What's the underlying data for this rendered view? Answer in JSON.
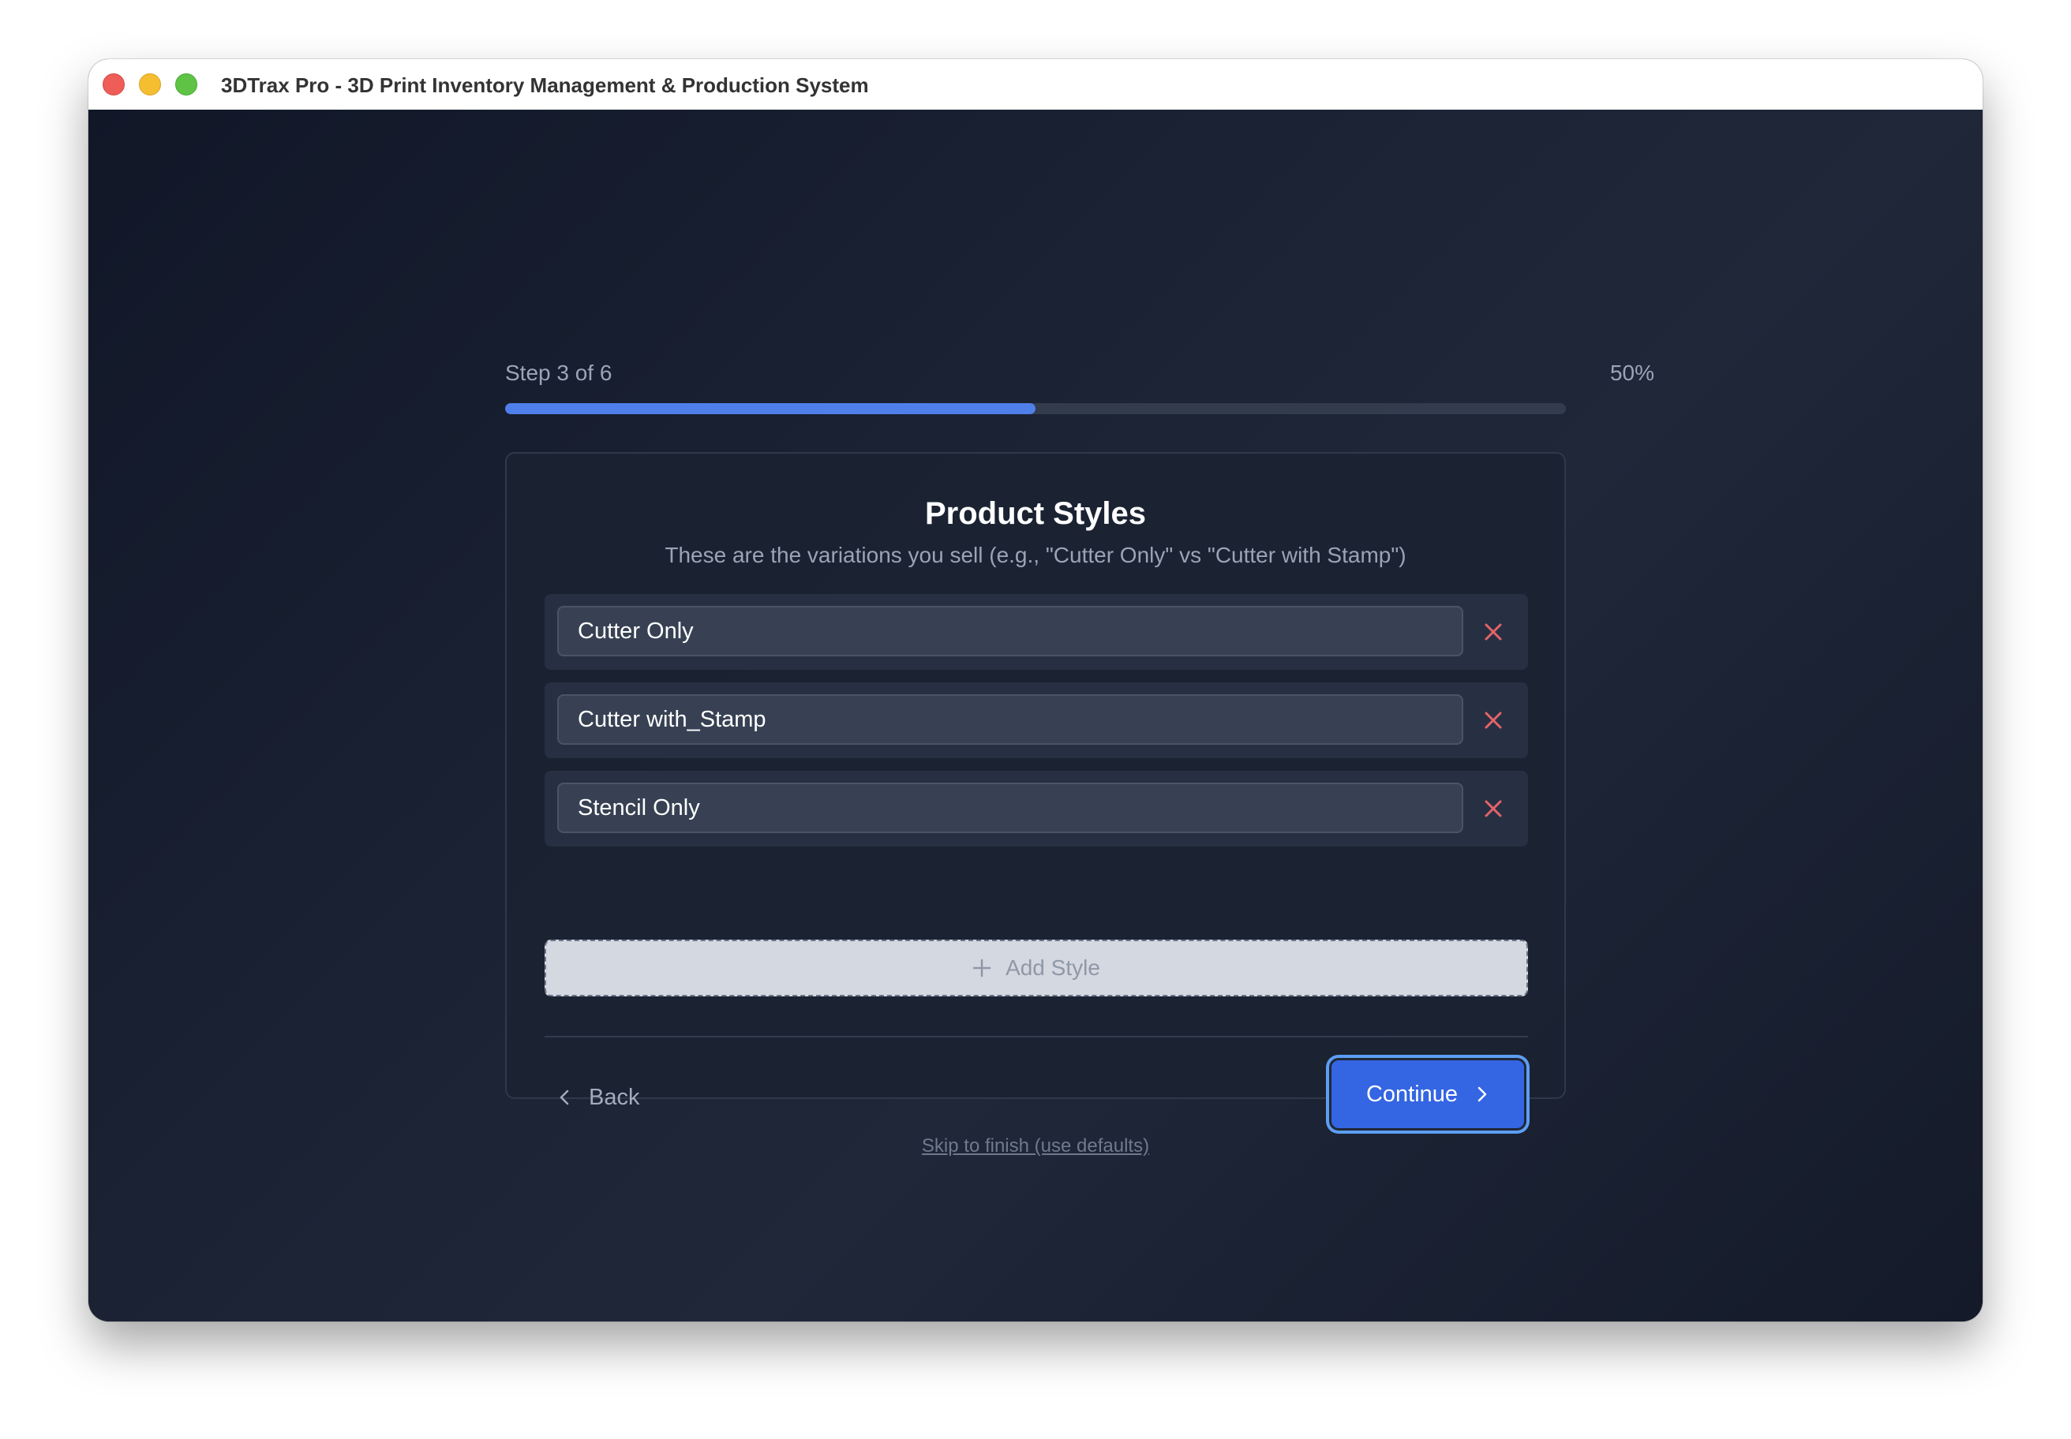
{
  "window": {
    "title": "3DTrax Pro - 3D Print Inventory Management & Production System"
  },
  "progress": {
    "step_label": "Step 3 of 6",
    "percent_label": "50%",
    "value": 0.5,
    "fill_color": "#4f7fea"
  },
  "card": {
    "title": "Product Styles",
    "subtitle": "These are the variations you sell (e.g., \"Cutter Only\" vs \"Cutter with Stamp\")",
    "styles": [
      {
        "value": "Cutter Only",
        "remove_icon": "close-icon"
      },
      {
        "value": "Cutter with_Stamp",
        "remove_icon": "close-icon"
      },
      {
        "value": "Stencil Only",
        "remove_icon": "close-icon"
      }
    ],
    "add_style_label": "Add Style",
    "back_label": "Back",
    "continue_label": "Continue"
  },
  "skip_link": "Skip to finish (use defaults)",
  "colors": {
    "accent": "#3465e2",
    "remove": "#e5636a",
    "focus_ring": "#5c9ef2"
  }
}
